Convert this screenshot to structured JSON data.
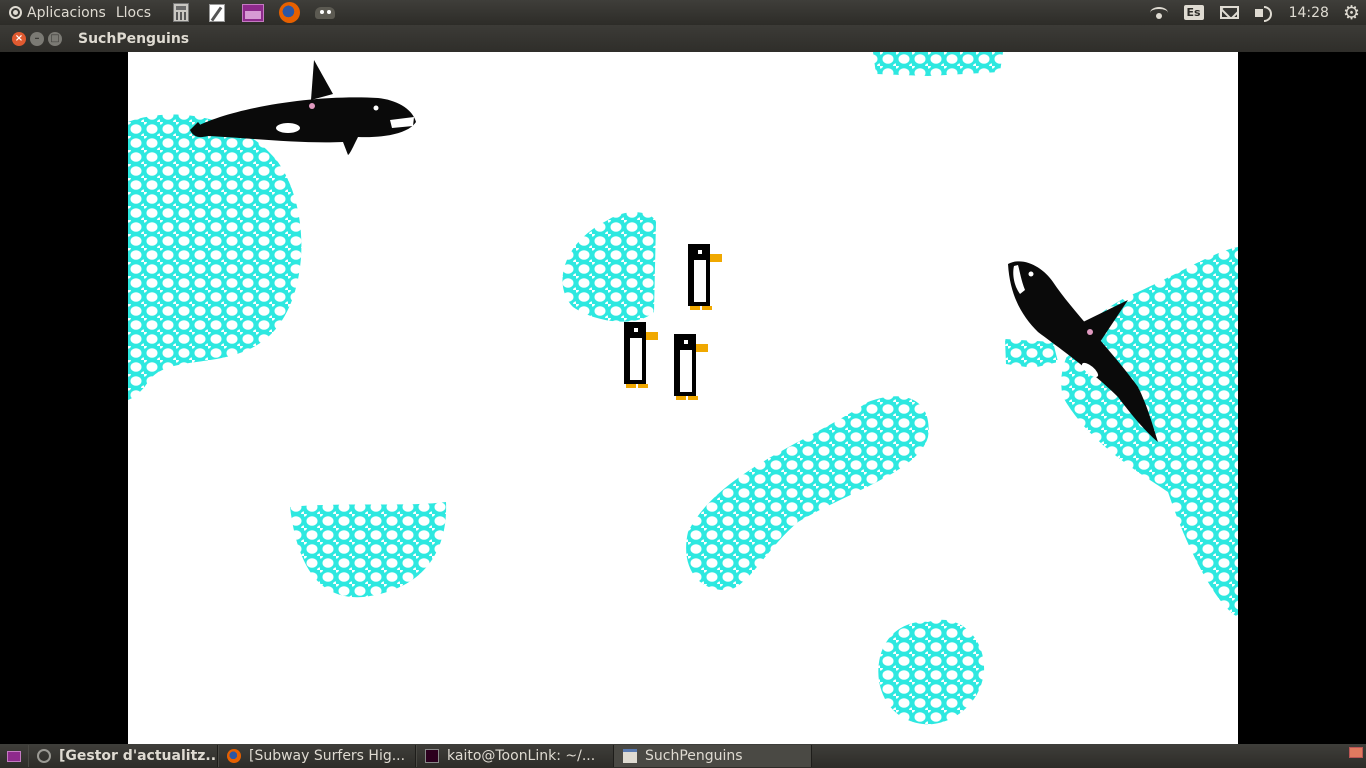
{
  "top_panel": {
    "menu": [
      "Aplicacions",
      "Llocs"
    ],
    "launchers": [
      "calculator-icon",
      "text-editor-icon",
      "desktop-icon",
      "firefox-icon",
      "gimp-icon"
    ],
    "keyboard_layout": "Es",
    "clock": "14:28"
  },
  "window": {
    "title": "SuchPenguins"
  },
  "game": {
    "background": "#ffffff",
    "ice_color": "#2ee8e0",
    "entities": {
      "orcas": 2,
      "penguins": 3,
      "ice_floes": 7
    }
  },
  "taskbar": {
    "tasks": [
      {
        "label": "[Gestor d'actualitz...",
        "icon": "update-manager-icon",
        "active": false
      },
      {
        "label": "[Subway Surfers Hig...",
        "icon": "firefox-icon",
        "active": false
      },
      {
        "label": "kaito@ToonLink: ~/...",
        "icon": "terminal-icon",
        "active": false
      },
      {
        "label": "SuchPenguins",
        "icon": "window-icon",
        "active": true
      }
    ]
  }
}
